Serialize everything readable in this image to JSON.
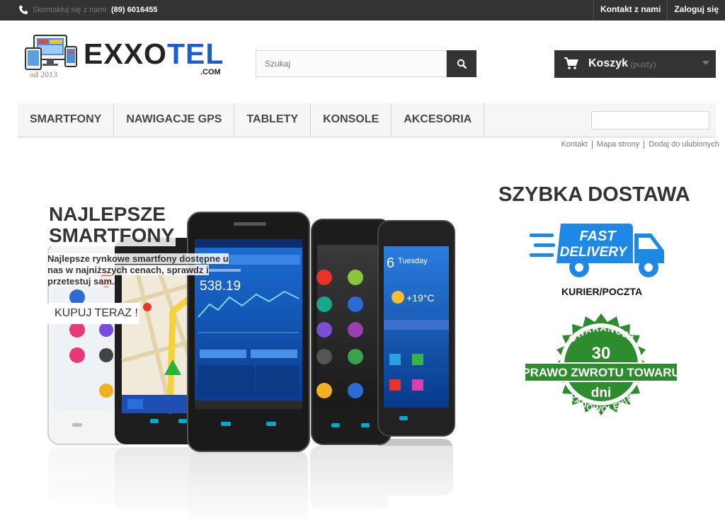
{
  "topbar": {
    "contact_label": "Skontaktuj się z nami:",
    "phone": "(89) 6016455",
    "links": [
      "Kontakt z nami",
      "Zaloguj się"
    ]
  },
  "logo": {
    "brand_part1": "EXXO",
    "brand_part2": "TEL",
    "domain": ".COM",
    "since": "od 2013"
  },
  "search": {
    "placeholder": "Szukaj"
  },
  "cart": {
    "label": "Koszyk",
    "status": "(pusty)"
  },
  "menu": {
    "items": [
      "Smartfony",
      "Nawigacje GPS",
      "Tablety",
      "Konsole",
      "Akcesoria"
    ]
  },
  "subnav": [
    "Kontakt",
    "Mapa strony",
    "Dodaj do ulubionych"
  ],
  "banner": {
    "title_line1": "NAJLEPSZE",
    "title_line2": "SMARTFONY",
    "text": "Najlepsze rynkowe smartfony dostępne u nas w najniższych cenach, sprawdz i przetestuj sam.",
    "button": "KUPUJ TERAZ !"
  },
  "right": {
    "delivery_title": "SZYBKA DOSTAWA",
    "truck_line1": "FAST",
    "truck_line2": "DELIVERY",
    "courier": "KURIER/POCZTA",
    "seal_top": "GWARANCJA",
    "seal_number": "30",
    "seal_band": "PRAWO ZWROTU TOWARU",
    "seal_unit": "dni",
    "seal_bottom": "ZADOWOLENIA"
  },
  "colors": {
    "dark": "#333333",
    "brand_blue": "#1e5ec9",
    "truck_blue": "#1e88e5",
    "seal_green": "#2e8b2e"
  }
}
